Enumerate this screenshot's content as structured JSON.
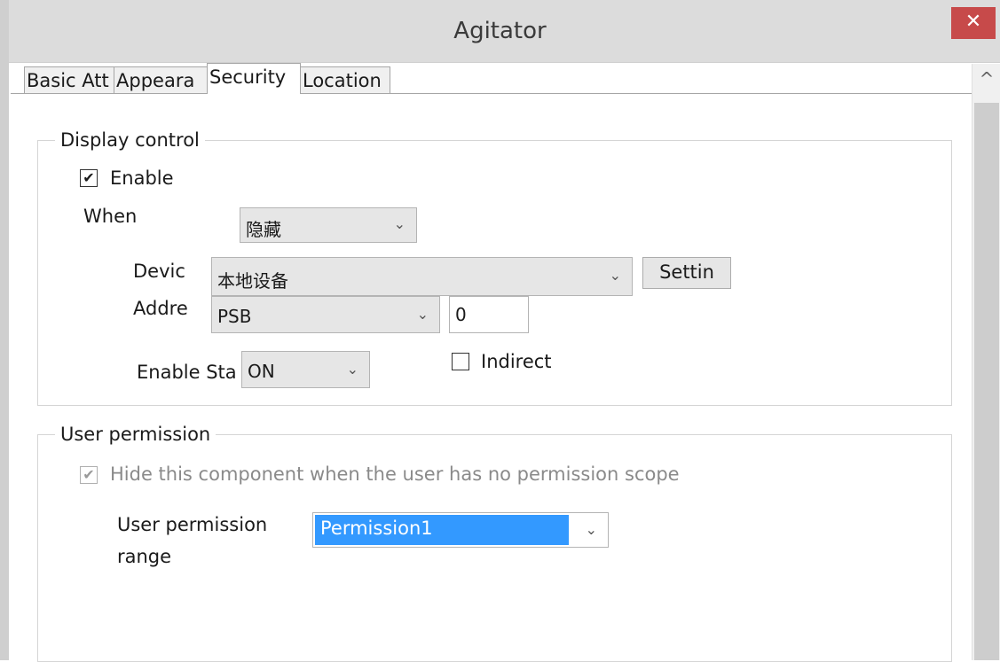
{
  "window": {
    "title": "Agitator",
    "close_glyph": "✕"
  },
  "tabs": [
    {
      "label": "Basic Att"
    },
    {
      "label": "Appeara"
    },
    {
      "label": "Security"
    },
    {
      "label": "Location"
    }
  ],
  "scrollbar": {
    "up_glyph": "^"
  },
  "display_control": {
    "group_label": "Display control",
    "enable_label": "Enable",
    "enable_checked": true,
    "when_label": "When",
    "when_value": "隐藏",
    "device_label": "Devic",
    "device_value": "本地设备",
    "settings_button": "Settin",
    "address_label": "Addre",
    "address_type": "PSB",
    "address_value": "0",
    "enable_state_label": "Enable Sta",
    "enable_state_value": "ON",
    "indirect_label": "Indirect",
    "indirect_checked": false
  },
  "user_permission": {
    "group_label": "User permission",
    "hide_label": "Hide this component when the user has no permission scope",
    "hide_checked": true,
    "range_label_line1": "User permission",
    "range_label_line2": "range",
    "range_value": "Permission1"
  },
  "icons": {
    "check": "✔",
    "dropdown_arrow": "⌄"
  },
  "colors": {
    "close_button": "#c74a4a",
    "selection_highlight": "#3399ff",
    "titlebar": "#dcdcdc"
  }
}
